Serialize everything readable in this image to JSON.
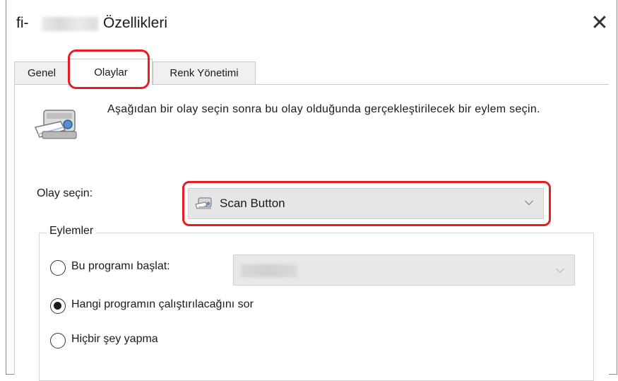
{
  "window": {
    "title_prefix": "fi-",
    "title_suffix": "Özellikleri",
    "close_glyph": "✕"
  },
  "tabs": [
    {
      "label": "Genel",
      "active": false
    },
    {
      "label": "Olaylar",
      "active": true
    },
    {
      "label": "Renk Yönetimi",
      "active": false
    }
  ],
  "events": {
    "instruction": "Aşağıdan bir olay seçin sonra bu olay olduğunda gerçekleştirilecek bir eylem seçin.",
    "select_label": "Olay seçin:",
    "selected_event": "Scan Button",
    "chevron": "⌵"
  },
  "actions": {
    "group_label": "Eylemler",
    "options": [
      {
        "label": "Bu programı başlat:",
        "checked": false
      },
      {
        "label": "Hangi programın çalıştırılacağını sor",
        "checked": true
      },
      {
        "label": "Hiçbir şey yapma",
        "checked": false
      }
    ],
    "program_chevron": "⌵"
  },
  "colors": {
    "highlight": "#e81c24",
    "dropdown_bg": "#e6e6e6"
  },
  "icons": {
    "scanner": "scanner-icon",
    "scan_button": "scanner-small-icon"
  }
}
